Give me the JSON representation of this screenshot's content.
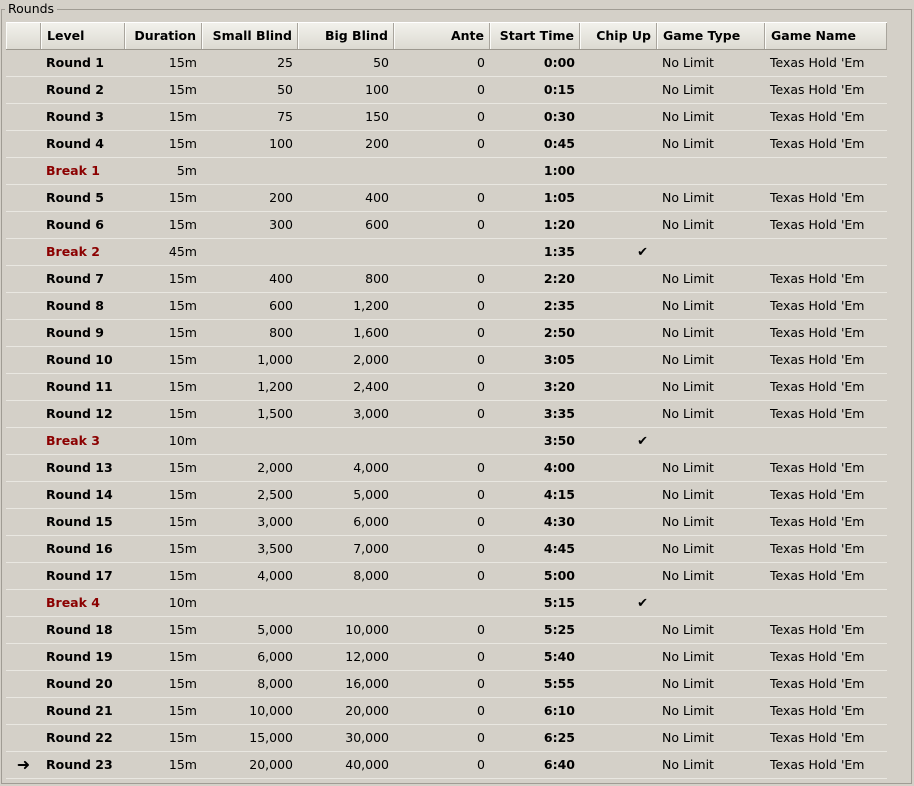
{
  "group": {
    "title": "Rounds"
  },
  "columns": [
    "",
    "Level",
    "Duration",
    "Small Blind",
    "Big Blind",
    "Ante",
    "Start Time",
    "Chip Up",
    "Game Type",
    "Game Name"
  ],
  "rows": [
    {
      "level": "Round 1",
      "duration": "15m",
      "small_blind": "25",
      "big_blind": "50",
      "ante": "0",
      "start_time": "0:00",
      "chip_up": "",
      "game_type": "No Limit",
      "game_name": "Texas Hold 'Em",
      "is_break": false,
      "current": false
    },
    {
      "level": "Round 2",
      "duration": "15m",
      "small_blind": "50",
      "big_blind": "100",
      "ante": "0",
      "start_time": "0:15",
      "chip_up": "",
      "game_type": "No Limit",
      "game_name": "Texas Hold 'Em",
      "is_break": false,
      "current": false
    },
    {
      "level": "Round 3",
      "duration": "15m",
      "small_blind": "75",
      "big_blind": "150",
      "ante": "0",
      "start_time": "0:30",
      "chip_up": "",
      "game_type": "No Limit",
      "game_name": "Texas Hold 'Em",
      "is_break": false,
      "current": false
    },
    {
      "level": "Round 4",
      "duration": "15m",
      "small_blind": "100",
      "big_blind": "200",
      "ante": "0",
      "start_time": "0:45",
      "chip_up": "",
      "game_type": "No Limit",
      "game_name": "Texas Hold 'Em",
      "is_break": false,
      "current": false
    },
    {
      "level": "Break 1",
      "duration": "5m",
      "small_blind": "",
      "big_blind": "",
      "ante": "",
      "start_time": "1:00",
      "chip_up": "",
      "game_type": "",
      "game_name": "",
      "is_break": true,
      "current": false
    },
    {
      "level": "Round 5",
      "duration": "15m",
      "small_blind": "200",
      "big_blind": "400",
      "ante": "0",
      "start_time": "1:05",
      "chip_up": "",
      "game_type": "No Limit",
      "game_name": "Texas Hold 'Em",
      "is_break": false,
      "current": false
    },
    {
      "level": "Round 6",
      "duration": "15m",
      "small_blind": "300",
      "big_blind": "600",
      "ante": "0",
      "start_time": "1:20",
      "chip_up": "",
      "game_type": "No Limit",
      "game_name": "Texas Hold 'Em",
      "is_break": false,
      "current": false
    },
    {
      "level": "Break 2",
      "duration": "45m",
      "small_blind": "",
      "big_blind": "",
      "ante": "",
      "start_time": "1:35",
      "chip_up": "✔",
      "game_type": "",
      "game_name": "",
      "is_break": true,
      "current": false
    },
    {
      "level": "Round 7",
      "duration": "15m",
      "small_blind": "400",
      "big_blind": "800",
      "ante": "0",
      "start_time": "2:20",
      "chip_up": "",
      "game_type": "No Limit",
      "game_name": "Texas Hold 'Em",
      "is_break": false,
      "current": false
    },
    {
      "level": "Round 8",
      "duration": "15m",
      "small_blind": "600",
      "big_blind": "1,200",
      "ante": "0",
      "start_time": "2:35",
      "chip_up": "",
      "game_type": "No Limit",
      "game_name": "Texas Hold 'Em",
      "is_break": false,
      "current": false
    },
    {
      "level": "Round 9",
      "duration": "15m",
      "small_blind": "800",
      "big_blind": "1,600",
      "ante": "0",
      "start_time": "2:50",
      "chip_up": "",
      "game_type": "No Limit",
      "game_name": "Texas Hold 'Em",
      "is_break": false,
      "current": false
    },
    {
      "level": "Round 10",
      "duration": "15m",
      "small_blind": "1,000",
      "big_blind": "2,000",
      "ante": "0",
      "start_time": "3:05",
      "chip_up": "",
      "game_type": "No Limit",
      "game_name": "Texas Hold 'Em",
      "is_break": false,
      "current": false
    },
    {
      "level": "Round 11",
      "duration": "15m",
      "small_blind": "1,200",
      "big_blind": "2,400",
      "ante": "0",
      "start_time": "3:20",
      "chip_up": "",
      "game_type": "No Limit",
      "game_name": "Texas Hold 'Em",
      "is_break": false,
      "current": false
    },
    {
      "level": "Round 12",
      "duration": "15m",
      "small_blind": "1,500",
      "big_blind": "3,000",
      "ante": "0",
      "start_time": "3:35",
      "chip_up": "",
      "game_type": "No Limit",
      "game_name": "Texas Hold 'Em",
      "is_break": false,
      "current": false
    },
    {
      "level": "Break 3",
      "duration": "10m",
      "small_blind": "",
      "big_blind": "",
      "ante": "",
      "start_time": "3:50",
      "chip_up": "✔",
      "game_type": "",
      "game_name": "",
      "is_break": true,
      "current": false
    },
    {
      "level": "Round 13",
      "duration": "15m",
      "small_blind": "2,000",
      "big_blind": "4,000",
      "ante": "0",
      "start_time": "4:00",
      "chip_up": "",
      "game_type": "No Limit",
      "game_name": "Texas Hold 'Em",
      "is_break": false,
      "current": false
    },
    {
      "level": "Round 14",
      "duration": "15m",
      "small_blind": "2,500",
      "big_blind": "5,000",
      "ante": "0",
      "start_time": "4:15",
      "chip_up": "",
      "game_type": "No Limit",
      "game_name": "Texas Hold 'Em",
      "is_break": false,
      "current": false
    },
    {
      "level": "Round 15",
      "duration": "15m",
      "small_blind": "3,000",
      "big_blind": "6,000",
      "ante": "0",
      "start_time": "4:30",
      "chip_up": "",
      "game_type": "No Limit",
      "game_name": "Texas Hold 'Em",
      "is_break": false,
      "current": false
    },
    {
      "level": "Round 16",
      "duration": "15m",
      "small_blind": "3,500",
      "big_blind": "7,000",
      "ante": "0",
      "start_time": "4:45",
      "chip_up": "",
      "game_type": "No Limit",
      "game_name": "Texas Hold 'Em",
      "is_break": false,
      "current": false
    },
    {
      "level": "Round 17",
      "duration": "15m",
      "small_blind": "4,000",
      "big_blind": "8,000",
      "ante": "0",
      "start_time": "5:00",
      "chip_up": "",
      "game_type": "No Limit",
      "game_name": "Texas Hold 'Em",
      "is_break": false,
      "current": false
    },
    {
      "level": "Break 4",
      "duration": "10m",
      "small_blind": "",
      "big_blind": "",
      "ante": "",
      "start_time": "5:15",
      "chip_up": "✔",
      "game_type": "",
      "game_name": "",
      "is_break": true,
      "current": false
    },
    {
      "level": "Round 18",
      "duration": "15m",
      "small_blind": "5,000",
      "big_blind": "10,000",
      "ante": "0",
      "start_time": "5:25",
      "chip_up": "",
      "game_type": "No Limit",
      "game_name": "Texas Hold 'Em",
      "is_break": false,
      "current": false
    },
    {
      "level": "Round 19",
      "duration": "15m",
      "small_blind": "6,000",
      "big_blind": "12,000",
      "ante": "0",
      "start_time": "5:40",
      "chip_up": "",
      "game_type": "No Limit",
      "game_name": "Texas Hold 'Em",
      "is_break": false,
      "current": false
    },
    {
      "level": "Round 20",
      "duration": "15m",
      "small_blind": "8,000",
      "big_blind": "16,000",
      "ante": "0",
      "start_time": "5:55",
      "chip_up": "",
      "game_type": "No Limit",
      "game_name": "Texas Hold 'Em",
      "is_break": false,
      "current": false
    },
    {
      "level": "Round 21",
      "duration": "15m",
      "small_blind": "10,000",
      "big_blind": "20,000",
      "ante": "0",
      "start_time": "6:10",
      "chip_up": "",
      "game_type": "No Limit",
      "game_name": "Texas Hold 'Em",
      "is_break": false,
      "current": false
    },
    {
      "level": "Round 22",
      "duration": "15m",
      "small_blind": "15,000",
      "big_blind": "30,000",
      "ante": "0",
      "start_time": "6:25",
      "chip_up": "",
      "game_type": "No Limit",
      "game_name": "Texas Hold 'Em",
      "is_break": false,
      "current": false
    },
    {
      "level": "Round 23",
      "duration": "15m",
      "small_blind": "20,000",
      "big_blind": "40,000",
      "ante": "0",
      "start_time": "6:40",
      "chip_up": "",
      "game_type": "No Limit",
      "game_name": "Texas Hold 'Em",
      "is_break": false,
      "current": true
    }
  ],
  "current_marker": "➜",
  "current_marker_icon": "arrow-right-icon",
  "chip_up_icon": "checkmark-icon",
  "colors": {
    "break_level": "#8b0000",
    "background": "#d4d0c8"
  }
}
